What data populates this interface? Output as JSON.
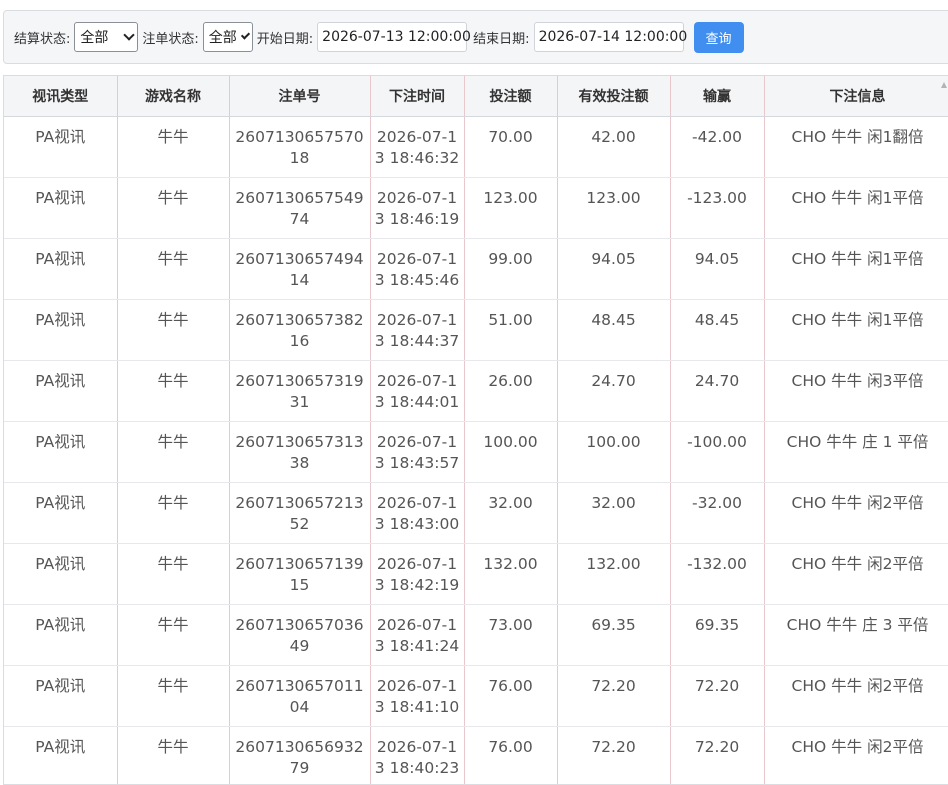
{
  "filters": {
    "settle_label": "结算状态:",
    "settle_value": "全部",
    "order_label": "注单状态:",
    "order_value": "全部",
    "start_label": "开始日期:",
    "start_value": "2026-07-13 12:00:00",
    "end_label": "结束日期:",
    "end_value": "2026-07-14 12:00:00",
    "query_label": "查询"
  },
  "table": {
    "headers": [
      "视讯类型",
      "游戏名称",
      "注单号",
      "下注时间",
      "投注额",
      "有效投注额",
      "输赢",
      "下注信息"
    ],
    "rows": [
      [
        "PA视讯",
        "牛牛",
        "260713065757018",
        "2026-07-13 18:46:32",
        "70.00",
        "42.00",
        "-42.00",
        "CHO 牛牛 闲1翻倍"
      ],
      [
        "PA视讯",
        "牛牛",
        "260713065754974",
        "2026-07-13 18:46:19",
        "123.00",
        "123.00",
        "-123.00",
        "CHO 牛牛 闲1平倍"
      ],
      [
        "PA视讯",
        "牛牛",
        "260713065749414",
        "2026-07-13 18:45:46",
        "99.00",
        "94.05",
        "94.05",
        "CHO 牛牛 闲1平倍"
      ],
      [
        "PA视讯",
        "牛牛",
        "260713065738216",
        "2026-07-13 18:44:37",
        "51.00",
        "48.45",
        "48.45",
        "CHO 牛牛 闲1平倍"
      ],
      [
        "PA视讯",
        "牛牛",
        "260713065731931",
        "2026-07-13 18:44:01",
        "26.00",
        "24.70",
        "24.70",
        "CHO 牛牛 闲3平倍"
      ],
      [
        "PA视讯",
        "牛牛",
        "260713065731338",
        "2026-07-13 18:43:57",
        "100.00",
        "100.00",
        "-100.00",
        "CHO 牛牛 庄 1 平倍"
      ],
      [
        "PA视讯",
        "牛牛",
        "260713065721352",
        "2026-07-13 18:43:00",
        "32.00",
        "32.00",
        "-32.00",
        "CHO 牛牛 闲2平倍"
      ],
      [
        "PA视讯",
        "牛牛",
        "260713065713915",
        "2026-07-13 18:42:19",
        "132.00",
        "132.00",
        "-132.00",
        "CHO 牛牛 闲2平倍"
      ],
      [
        "PA视讯",
        "牛牛",
        "260713065703649",
        "2026-07-13 18:41:24",
        "73.00",
        "69.35",
        "69.35",
        "CHO 牛牛 庄 3 平倍"
      ],
      [
        "PA视讯",
        "牛牛",
        "260713065701104",
        "2026-07-13 18:41:10",
        "76.00",
        "72.20",
        "72.20",
        "CHO 牛牛 闲2平倍"
      ],
      [
        "PA视讯",
        "牛牛",
        "260713065693279",
        "2026-07-13 18:40:23",
        "76.00",
        "72.20",
        "72.20",
        "CHO 牛牛 闲2平倍"
      ]
    ]
  }
}
